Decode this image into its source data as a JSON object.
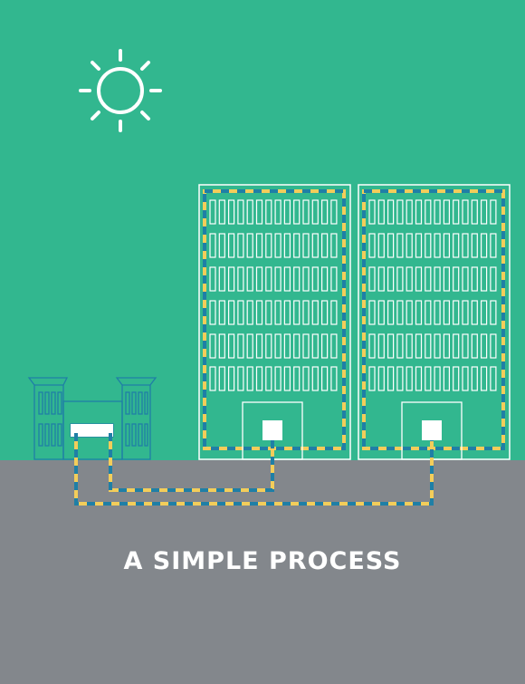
{
  "title": "A SIMPLE PROCESS",
  "colors": {
    "sky": "#32b78f",
    "ground": "#83878c",
    "building_outline": "#ffffff",
    "plant_outline": "#1f7fa6",
    "wire_yellow": "#f3cd5a",
    "wire_blue": "#1f7fa6"
  },
  "icons": [
    "sun-icon",
    "office-building-icon",
    "power-plant-icon",
    "cable-line"
  ]
}
